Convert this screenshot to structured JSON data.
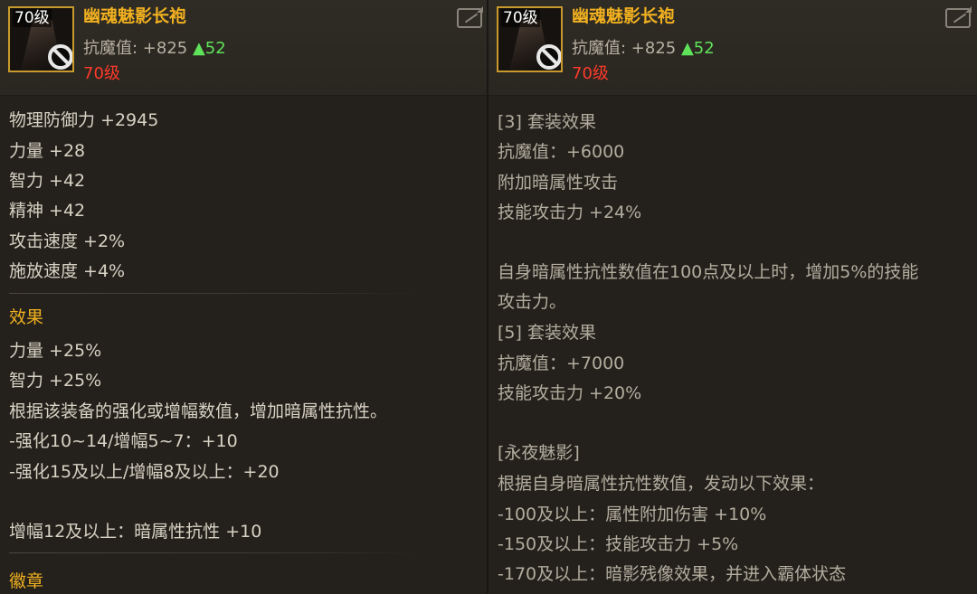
{
  "left": {
    "item_name": "幽魂魅影长袍",
    "level_tag": "70级",
    "resist_label": "抗魔值: +825",
    "resist_up": "▲52",
    "required_level": "70级",
    "stats": [
      "物理防御力 +2945",
      "力量 +28",
      "智力 +42",
      "精神 +42",
      "攻击速度 +2%",
      "施放速度 +4%"
    ],
    "effect_title": "效果",
    "effects": [
      "力量 +25%",
      "智力 +25%",
      "根据该装备的强化或增幅数值，增加暗属性抗性。",
      "-强化10~14/增幅5~7：+10",
      "-强化15及以上/增幅8及以上：+20",
      "增幅12及以上：暗属性抗性 +10"
    ],
    "badge_title": "徽章"
  },
  "right": {
    "item_name": "幽魂魅影长袍",
    "level_tag": "70级",
    "resist_label": "抗魔值: +825",
    "resist_up": "▲52",
    "required_level": "70级",
    "lines": [
      "[3] 套装效果",
      "抗魔值：+6000",
      "附加暗属性攻击",
      "技能攻击力 +24%",
      "自身暗属性抗性数值在100点及以上时，增加5%的技能",
      "攻击力。",
      "[5] 套装效果",
      "抗魔值：+7000",
      "技能攻击力 +20%",
      "[永夜魅影]",
      "根据自身暗属性抗性数值，发动以下效果：",
      "-100及以上：属性附加伤害 +10%",
      "-150及以上：技能攻击力 +5%",
      "-170及以上：暗影残像效果，并进入霸体状态"
    ]
  },
  "icons": [
    "share-icon",
    "forbidden-icon"
  ]
}
